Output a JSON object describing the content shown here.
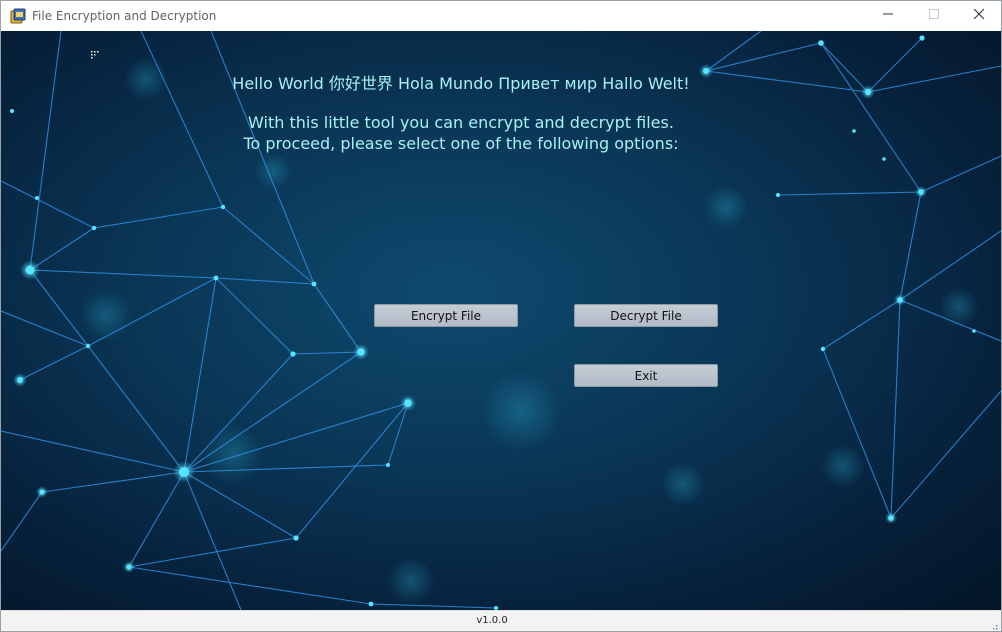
{
  "window": {
    "title": "File Encryption and Decryption",
    "icons": {
      "app": "app-icon",
      "minimize": "minimize-icon",
      "maximize": "maximize-icon",
      "close": "close-icon"
    }
  },
  "main": {
    "greeting": "Hello World 你好世界 Hola Mundo Привет мир Hallo Welt!",
    "description_line1": "With this little tool you can encrypt and decrypt files.",
    "description_line2": "To proceed, please select one of the following options:"
  },
  "buttons": {
    "encrypt_label": "Encrypt File",
    "decrypt_label": "Decrypt File",
    "exit_label": "Exit"
  },
  "status": {
    "version": "v1.0.0"
  },
  "colors": {
    "background": "#0a3656",
    "text_accent": "#a6f2f5",
    "network_line": "#2f8de0",
    "network_node": "#55e6ff",
    "button_face": "#b8c1cc"
  }
}
